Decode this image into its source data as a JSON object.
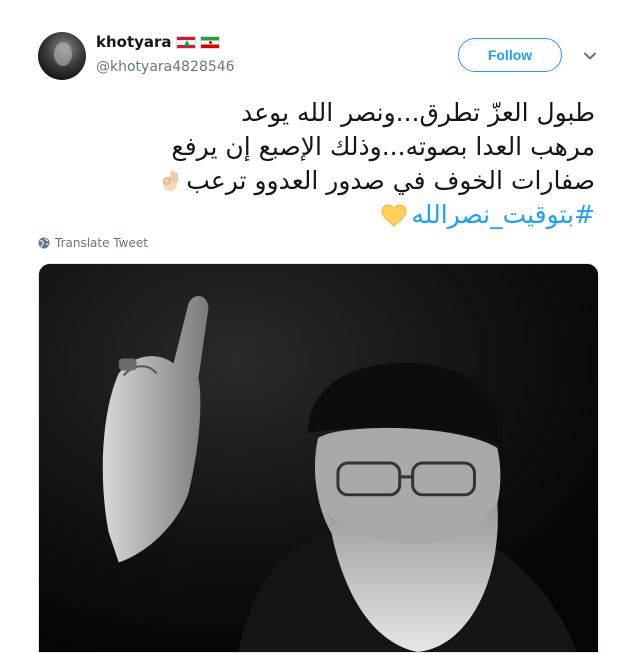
{
  "user": {
    "display_name": "khotyara",
    "handle": "@khotyara4828546",
    "flags": [
      "lebanon-flag-icon",
      "iran-flag-icon"
    ]
  },
  "actions": {
    "follow_label": "Follow",
    "more_icon": "chevron-down-icon"
  },
  "tweet": {
    "lines": [
      "طبول العزّ تطرق...ونصر الله يوعد",
      "مرهب العدا بصوته...وذلك الإصبع إن يرفع",
      "صفارات الخوف في صدور العدوو ترعب"
    ],
    "line3_emoji": "ok-hand-emoji",
    "hashtag": "#بتوقيت_نصرالله",
    "hashtag_emoji": "yellow-heart-emoji"
  },
  "translate": {
    "label": "Translate Tweet",
    "icon": "globe-icon"
  },
  "media": {
    "description_icon": "photo"
  },
  "colors": {
    "accent": "#1da1f2",
    "text": "#14171a",
    "secondary": "#657786"
  }
}
